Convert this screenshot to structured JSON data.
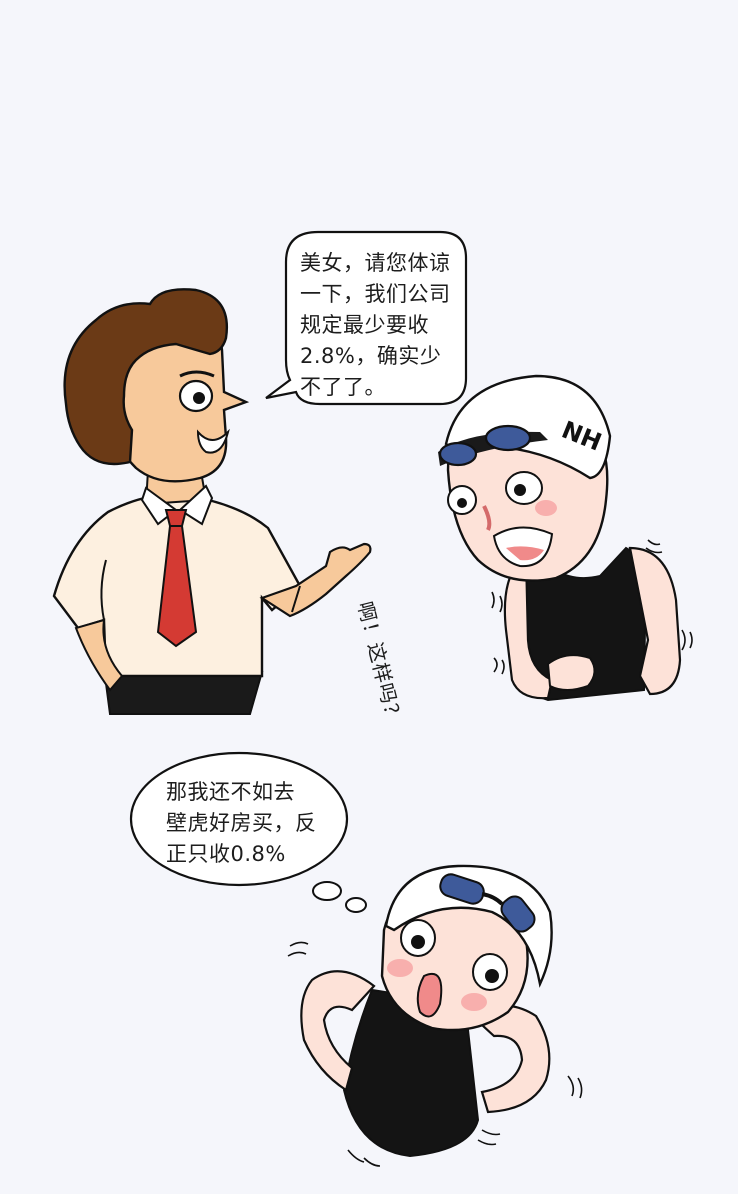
{
  "panel_1": {
    "man_speech_lines": [
      "美女，请您体谅",
      "一下，我们公司",
      "规定最少要收",
      "2.8%，确实少",
      "不了了。"
    ],
    "woman_reaction": "啊！这样吗？",
    "cap_logo": "NH"
  },
  "panel_2": {
    "thought_lines": [
      "那我还不如去",
      "壁虎好房买，反",
      "正只收0.8%"
    ]
  },
  "colors": {
    "background": "#f5f6fb",
    "hair": "#6b3a16",
    "skin_man": "#f7c99b",
    "shirt": "#fdf0e0",
    "tie": "#d43a33",
    "skin_woman": "#fde2d8",
    "swimsuit": "#111111",
    "goggles": "#3e5a9a"
  }
}
